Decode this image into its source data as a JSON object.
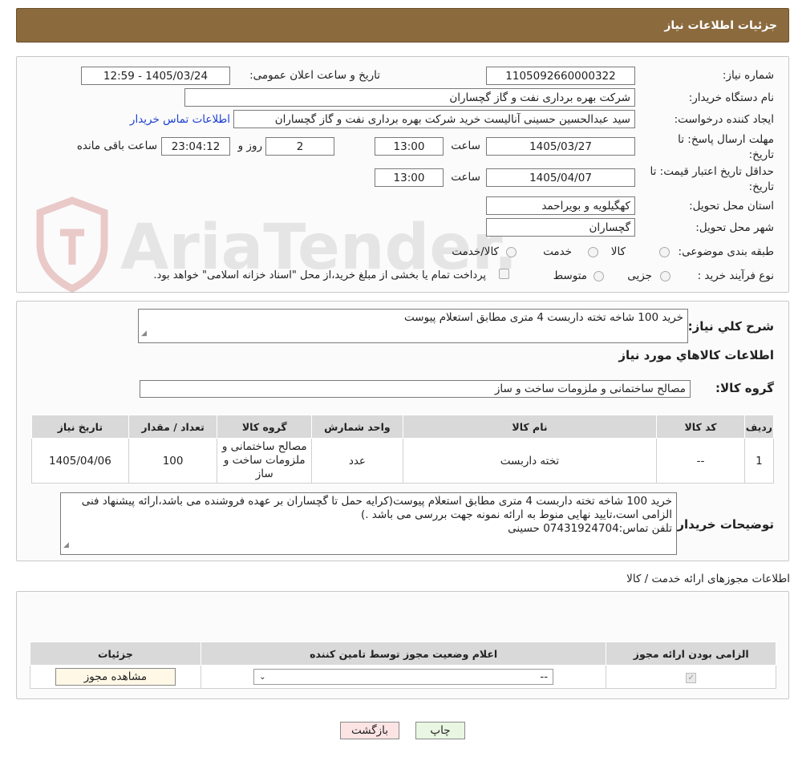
{
  "header": {
    "title": "جزئیات اطلاعات نیاز"
  },
  "form": {
    "need_number": {
      "label": "شماره نیاز:",
      "value": "1105092660000322"
    },
    "announce": {
      "label": "تاریخ و ساعت اعلان عمومی:",
      "value": "1405/03/24 - 12:59"
    },
    "buyer": {
      "label": "نام دستگاه خریدار:",
      "value": "شرکت بهره برداری نفت و گاز گچساران"
    },
    "creator": {
      "label": "ایجاد کننده درخواست:",
      "value": "سید عبدالحسین حسینی آنالیست خرید شرکت بهره برداری نفت و گاز گچساران",
      "contact_link": "اطلاعات تماس خریدار"
    },
    "reply_deadline": {
      "label": "مهلت ارسال پاسخ: تا تاریخ:",
      "date": "1405/03/27",
      "time_label": "ساعت",
      "time": "13:00",
      "days": "2",
      "days_label": "روز و",
      "remaining": "23:04:12",
      "remaining_label": "ساعت باقی مانده"
    },
    "price_validity": {
      "label": "حداقل تاریخ اعتبار قیمت: تا تاریخ:",
      "date": "1405/04/07",
      "time_label": "ساعت",
      "time": "13:00"
    },
    "province": {
      "label": "استان محل تحویل:",
      "value": "کهگیلویه و بویراحمد"
    },
    "city": {
      "label": "شهر محل تحویل:",
      "value": "گچساران"
    },
    "category": {
      "label": "طبقه بندی موضوعی:",
      "options": [
        "کالا",
        "خدمت",
        "کالا/خدمت"
      ]
    },
    "process": {
      "label": "نوع فرآیند خرید :",
      "options": [
        "جزیی",
        "متوسط"
      ],
      "payment_note": "پرداخت تمام یا بخشی از مبلغ خرید،از محل \"اسناد خزانه اسلامی\" خواهد بود."
    }
  },
  "summary": {
    "label": "شرح کلي نياز:",
    "value": "خرید 100 شاخه تخته داربست 4 متری مطابق استعلام پیوست",
    "goods_info_title": "اطلاعات کالاهاي مورد نياز",
    "group_label": "گروه کالا:",
    "group_value": "مصالح ساختمانی و ملزومات ساخت و ساز"
  },
  "goods_table": {
    "headers": [
      "ردیف",
      "کد کالا",
      "نام کالا",
      "واحد شمارش",
      "گروه کالا",
      "تعداد / مقدار",
      "تاریخ نیاز"
    ],
    "rows": [
      [
        "1",
        "--",
        "تخته داربست",
        "عدد",
        "مصالح ساختمانی و ملزومات ساخت و ساز",
        "100",
        "1405/04/06"
      ]
    ]
  },
  "buyer_notes": {
    "label": "توضیحات خریدار:",
    "value": "خرید 100 شاخه تخته داربست 4 متری مطابق استعلام پیوست(کرایه حمل تا گچساران بر عهده فروشنده می باشد،ارائه پیشنهاد فنی الزامی است،تایید نهایی منوط به ارائه نمونه جهت بررسی می باشد .)\nتلفن تماس:07431924704   حسینی"
  },
  "permits": {
    "title": "اطلاعات مجوزهای ارائه خدمت / کالا",
    "headers": [
      "الزامی بودن ارائه مجوز",
      "اعلام وضعیت مجوز توسط تامین کننده",
      "جزئیات"
    ],
    "select_value": "--",
    "view_button": "مشاهده مجوز"
  },
  "buttons": {
    "print": "چاپ",
    "back": "بازگشت"
  },
  "watermark": {
    "text": "AriaTender.neT"
  },
  "colors": {
    "header_bg": "#8b6a3e",
    "link": "#1a3fd0",
    "back_bg": "#fde4e4",
    "print_bg": "#e9f7e2"
  }
}
